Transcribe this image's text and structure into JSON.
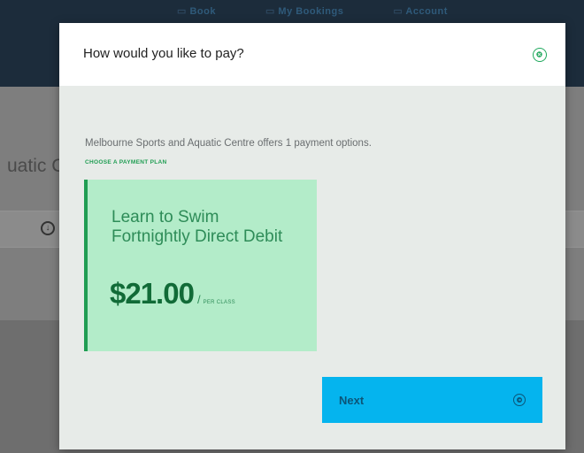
{
  "background": {
    "nav": [
      "Book",
      "My Bookings",
      "Account"
    ],
    "page_title_fragment": "uatic C"
  },
  "modal": {
    "title": "How would you like to pay?",
    "close_icon": "close-circle-icon",
    "intro": "Melbourne Sports and Aquatic Centre offers 1 payment options.",
    "plan_heading": "CHOOSE A PAYMENT PLAN",
    "plans": [
      {
        "name": "Learn to Swim Fortnightly Direct Debit",
        "price": "$21.00",
        "separator": "/",
        "period": "PER CLASS",
        "selected": true
      }
    ],
    "next_button": {
      "label": "Next",
      "icon": "arrow-right-circle-icon"
    }
  },
  "colors": {
    "accent_green": "#1f9d52",
    "plan_card_bg": "#b3ecc9",
    "next_button_bg": "#05b4ee",
    "header_dark": "#1c2c3b"
  }
}
